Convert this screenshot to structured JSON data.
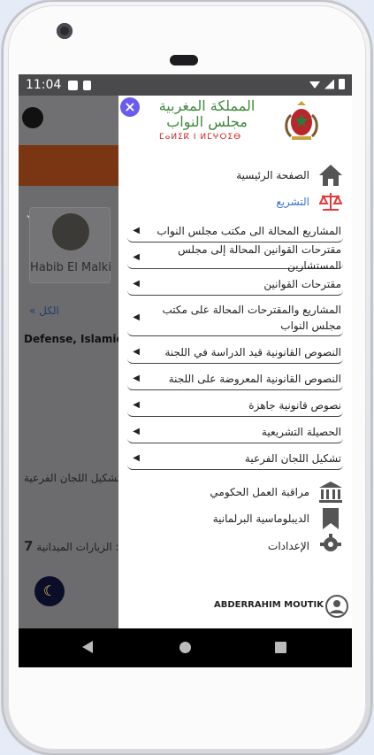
{
  "status": {
    "time": "11:04"
  },
  "background": {
    "card_name": "Habib El Malki",
    "all_link": "الكل",
    "defense_text": "Defense, Islamic A",
    "sub_committees_text": "تشكيل اللجان الفرعية :",
    "field_visits_text": "الزيارات الميدانية :",
    "field_visits_count": "7"
  },
  "logo": {
    "line1": "المملكة المغربية",
    "line2": "مجلس النواب",
    "line3": "ⵎⴰⵍⵉⴽ ⵏ ⵍⵎⵖⵔⵉⴱ"
  },
  "drawer": {
    "home_label": "الصفحة الرئيسية",
    "legislation_label": "التشريع",
    "legislation_items": [
      "المشاريع المحالة الى مكتب مجلس النواب",
      "مقترحات القوانين المحالة إلى مجلس المستشارين",
      "مقترحات القوانين",
      "المشاريع والمقترحات المحالة على مكتب مجلس النواب",
      "النصوص القانونية قيد الدراسة في اللجنة",
      "النصوص القانونية المعروضة على اللجنة",
      "نصوص قانونية جاهزة",
      "الحصيلة التشريعية",
      "تشكيل اللجان الفرعية"
    ],
    "government_control_label": "مراقبة العمل الحكومي",
    "diplomacy_label": "الديبلوماسية البرلمانية",
    "settings_label": "الإعدادات"
  },
  "user": {
    "name": "ABDERRAHIM MOUTIK"
  },
  "colors": {
    "accent": "#e23b3b",
    "active_link": "#3d6fd1",
    "close_button": "#6a5cf0"
  }
}
